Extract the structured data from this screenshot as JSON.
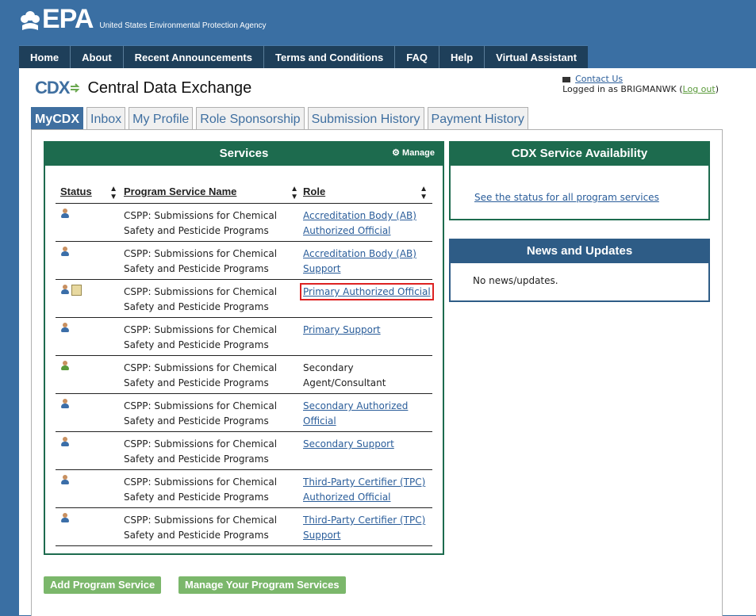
{
  "header": {
    "logo_text": "EPA",
    "agency": "United States Environmental Protection Agency"
  },
  "nav": [
    "Home",
    "About",
    "Recent Announcements",
    "Terms and Conditions",
    "FAQ",
    "Help",
    "Virtual Assistant"
  ],
  "app": {
    "logo_text": "CDX",
    "title": "Central Data Exchange"
  },
  "user": {
    "contact_label": "Contact Us",
    "logged_in_prefix": "Logged in as BRIGMANWK",
    "logout_label": "Log out"
  },
  "tabs": [
    "MyCDX",
    "Inbox",
    "My Profile",
    "Role Sponsorship",
    "Submission History",
    "Payment History"
  ],
  "services": {
    "title": "Services",
    "manage_label": "Manage",
    "columns": [
      "Status",
      "Program Service Name",
      "Role"
    ],
    "rows": [
      {
        "service": "CSPP: Submissions for Chemical Safety and Pesticide Programs",
        "role": "Accreditation Body (AB) Authorized Official",
        "link": true
      },
      {
        "service": "CSPP: Submissions for Chemical Safety and Pesticide Programs",
        "role": "Accreditation Body (AB) Support",
        "link": true
      },
      {
        "service": "CSPP: Submissions for Chemical Safety and Pesticide Programs",
        "role": "Primary Authorized Official",
        "link": true
      },
      {
        "service": "CSPP: Submissions for Chemical Safety and Pesticide Programs",
        "role": "Primary Support",
        "link": true
      },
      {
        "service": "CSPP: Submissions for Chemical Safety and Pesticide Programs",
        "role": "Secondary Agent/Consultant",
        "link": false
      },
      {
        "service": "CSPP: Submissions for Chemical Safety and Pesticide Programs",
        "role": "Secondary Authorized Official",
        "link": true
      },
      {
        "service": "CSPP: Submissions for Chemical Safety and Pesticide Programs",
        "role": "Secondary Support",
        "link": true
      },
      {
        "service": "CSPP: Submissions for Chemical Safety and Pesticide Programs",
        "role": "Third-Party Certifier (TPC) Authorized Official",
        "link": true
      },
      {
        "service": "CSPP: Submissions for Chemical Safety and Pesticide Programs",
        "role": "Third-Party Certifier (TPC) Support",
        "link": true
      }
    ]
  },
  "availability": {
    "title": "CDX Service Availability",
    "link": "See the status for all program services"
  },
  "news": {
    "title": "News and Updates",
    "text": "No news/updates."
  },
  "buttons": {
    "add": "Add Program Service",
    "manage": "Manage Your Program Services"
  },
  "colors": {
    "page_bg": "#3a6fa3",
    "nav_bg": "#1e3f5a",
    "services_green": "#1d6b4e",
    "news_blue": "#2e5c86",
    "button_green": "#7bb76b",
    "highlight_red": "#dd2222"
  }
}
